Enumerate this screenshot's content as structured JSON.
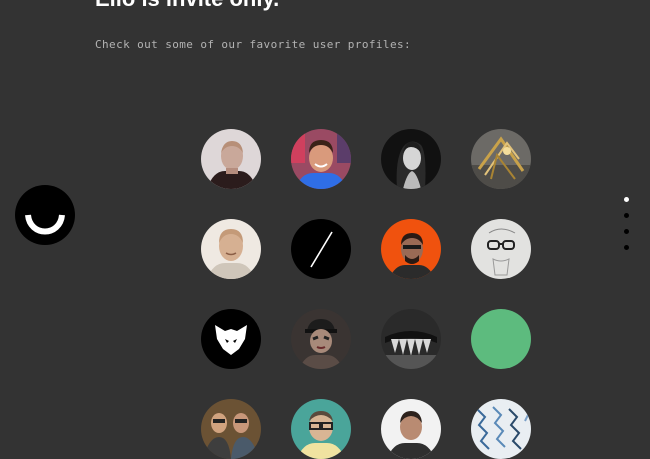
{
  "header": {
    "title": "Ello is invite only.",
    "subtitle": "Check out some of our favorite user profiles:"
  },
  "colors": {
    "background": "#333333",
    "green_avatar": "#5dbb7e",
    "orange_avatar": "#f0520e"
  },
  "logo": {
    "icon": "ello-smile-icon"
  },
  "profiles": [
    {
      "icon": "profile-photo-man-buzzcut"
    },
    {
      "icon": "profile-photo-smiling-man-blue-shirt"
    },
    {
      "icon": "profile-photo-woman-bw"
    },
    {
      "icon": "profile-photo-gold-sculpture"
    },
    {
      "icon": "profile-photo-bald-man"
    },
    {
      "icon": "profile-slash-logo"
    },
    {
      "icon": "profile-photo-man-orange-background"
    },
    {
      "icon": "profile-sketch-glasses"
    },
    {
      "icon": "profile-wolf-logo"
    },
    {
      "icon": "profile-photo-painted-face-cap"
    },
    {
      "icon": "profile-teeth-bw"
    },
    {
      "icon": "profile-green-circle"
    },
    {
      "icon": "profile-photo-group"
    },
    {
      "icon": "profile-photo-man-glasses-teal"
    },
    {
      "icon": "profile-photo-man-white-background"
    },
    {
      "icon": "profile-pattern-blue"
    }
  ],
  "pagination": {
    "total": 4,
    "active": 1
  }
}
